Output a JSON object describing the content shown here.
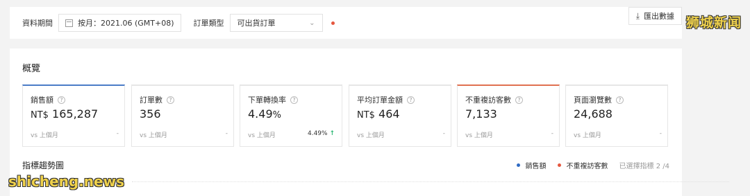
{
  "filter": {
    "period_label": "資料期間",
    "period_value": "按月：2021.06 (GMT+08)",
    "order_type_label": "訂單類型",
    "order_type_value": "可出貨訂單",
    "export_label": "匯出數據"
  },
  "overview": {
    "title": "概覽",
    "cards": [
      {
        "title": "銷售額",
        "currency": "NT$",
        "value": "165,287",
        "compare": "vs 上個月",
        "trend": "-",
        "accent": "#4a7cc7"
      },
      {
        "title": "訂單數",
        "value": "356",
        "compare": "vs 上個月",
        "trend": "-"
      },
      {
        "title": "下單轉換率",
        "value": "4.49",
        "unit": "%",
        "compare": "vs 上個月",
        "delta": "4.49%"
      },
      {
        "title": "平均訂單金額",
        "currency": "NT$",
        "value": "464",
        "compare": "vs 上個月",
        "trend": "-"
      },
      {
        "title": "不重複訪客數",
        "value": "7,133",
        "compare": "vs 上個月",
        "trend": "-",
        "accent": "#e07050"
      },
      {
        "title": "頁面瀏覽數",
        "value": "24,688",
        "compare": "vs 上個月",
        "trend": "-"
      }
    ]
  },
  "trend": {
    "title": "指標趨勢圖",
    "legend": [
      {
        "label": "銷售額",
        "color": "#2f6bc4"
      },
      {
        "label": "不重複訪客數",
        "color": "#e5573e"
      }
    ],
    "selected": "已選擇指標 2 /4"
  },
  "watermarks": {
    "top": "狮城新闻",
    "bottom": "shicheng.news"
  }
}
